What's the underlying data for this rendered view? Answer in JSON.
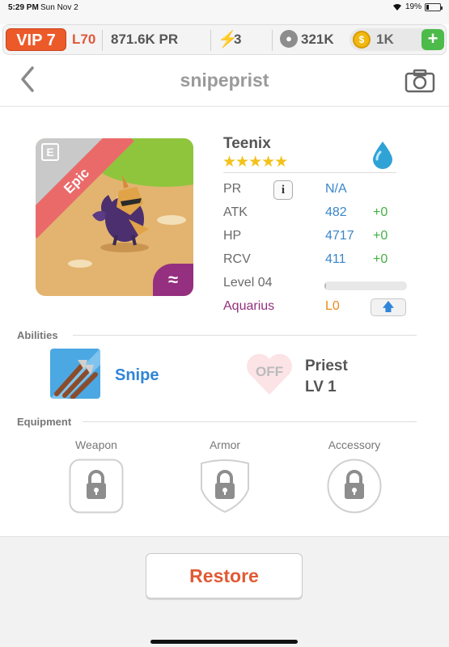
{
  "status_bar": {
    "time": "5:29 PM",
    "date": "Sun Nov 2",
    "battery": "19%"
  },
  "resources": {
    "vip": "VIP 7",
    "level": "L70",
    "pr": "871.6K PR",
    "energy": "3",
    "paw": "321K",
    "coins": "1K"
  },
  "header": {
    "title": "snipeprist"
  },
  "card": {
    "rarity": "Epic",
    "element_badge": "E",
    "sign_symbol": "≈"
  },
  "monster": {
    "name": "Teenix",
    "stars": "★★★★★",
    "stats": [
      {
        "label": "PR",
        "value": "N/A",
        "bonus": ""
      },
      {
        "label": "ATK",
        "value": "482",
        "bonus": "+0"
      },
      {
        "label": "HP",
        "value": "4717",
        "bonus": "+0"
      },
      {
        "label": "RCV",
        "value": "411",
        "bonus": "+0"
      }
    ],
    "level_label": "Level 04",
    "level_progress": 0.02,
    "sign": "Aquarius",
    "sign_level": "L0",
    "info_glyph": "i",
    "upgrade_glyph": "🡅"
  },
  "abilities": {
    "title": "Abilities",
    "skill_name": "Snipe",
    "leader_status": "OFF",
    "leader_name": "Priest",
    "leader_level": "LV 1"
  },
  "equipment": {
    "title": "Equipment",
    "slots": [
      "Weapon",
      "Armor",
      "Accessory"
    ]
  },
  "footer": {
    "restore_label": "Restore"
  },
  "colors": {
    "accent_orange": "#ec5a2a",
    "stat_blue": "#3a86c8",
    "bonus_green": "#43b043",
    "sign_purple": "#932f7d"
  }
}
